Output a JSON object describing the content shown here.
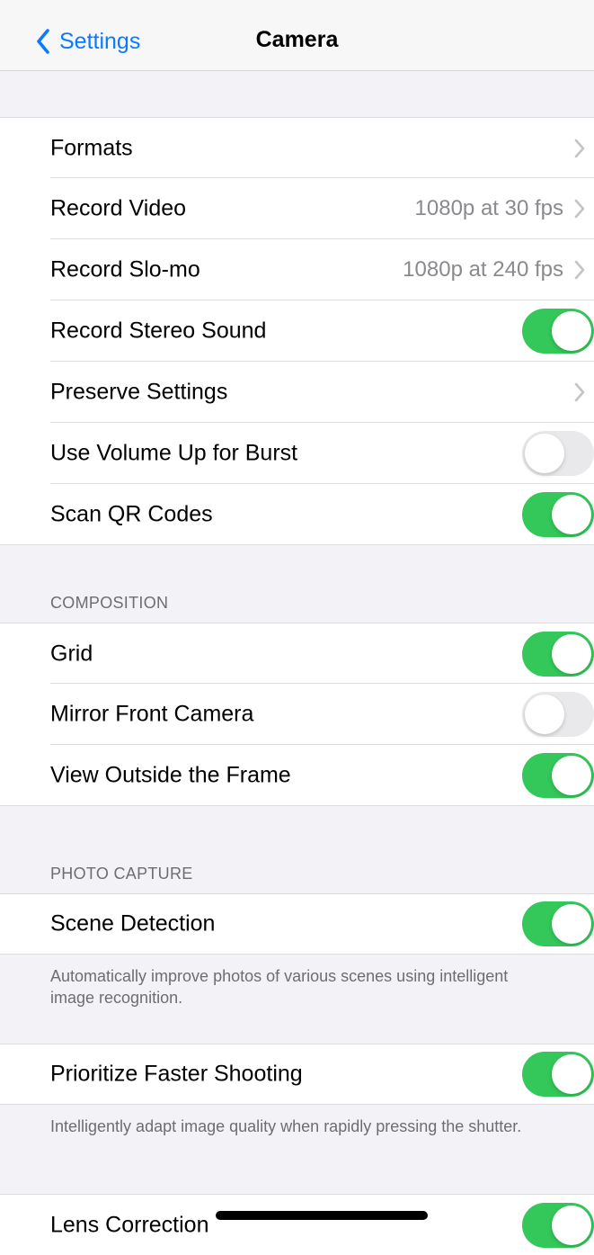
{
  "nav": {
    "back_label": "Settings",
    "title": "Camera"
  },
  "group1": [
    {
      "label": "Formats",
      "type": "link",
      "value": ""
    },
    {
      "label": "Record Video",
      "type": "link",
      "value": "1080p at 30 fps"
    },
    {
      "label": "Record Slo-mo",
      "type": "link",
      "value": "1080p at 240 fps"
    },
    {
      "label": "Record Stereo Sound",
      "type": "toggle",
      "on": true
    },
    {
      "label": "Preserve Settings",
      "type": "link",
      "value": ""
    },
    {
      "label": "Use Volume Up for Burst",
      "type": "toggle",
      "on": false
    },
    {
      "label": "Scan QR Codes",
      "type": "toggle",
      "on": true
    }
  ],
  "composition": {
    "header": "COMPOSITION",
    "items": [
      {
        "label": "Grid",
        "type": "toggle",
        "on": true
      },
      {
        "label": "Mirror Front Camera",
        "type": "toggle",
        "on": false
      },
      {
        "label": "View Outside the Frame",
        "type": "toggle",
        "on": true
      }
    ]
  },
  "photo_capture": {
    "header": "PHOTO CAPTURE",
    "scene_detection": {
      "label": "Scene Detection",
      "on": true
    },
    "scene_detection_footer": "Automatically improve photos of various scenes using intelligent image recognition.",
    "prioritize": {
      "label": "Prioritize Faster Shooting",
      "on": true
    },
    "prioritize_footer": "Intelligently adapt image quality when rapidly pressing the shutter.",
    "lens_correction": {
      "label": "Lens Correction",
      "on": true
    }
  },
  "colors": {
    "accent": "#0a7aff",
    "toggle_on": "#34c759",
    "toggle_off": "#e9e9eb",
    "background": "#f2f2f7"
  },
  "icons": {
    "back": "chevron-left-icon",
    "disclosure": "chevron-right-icon"
  }
}
